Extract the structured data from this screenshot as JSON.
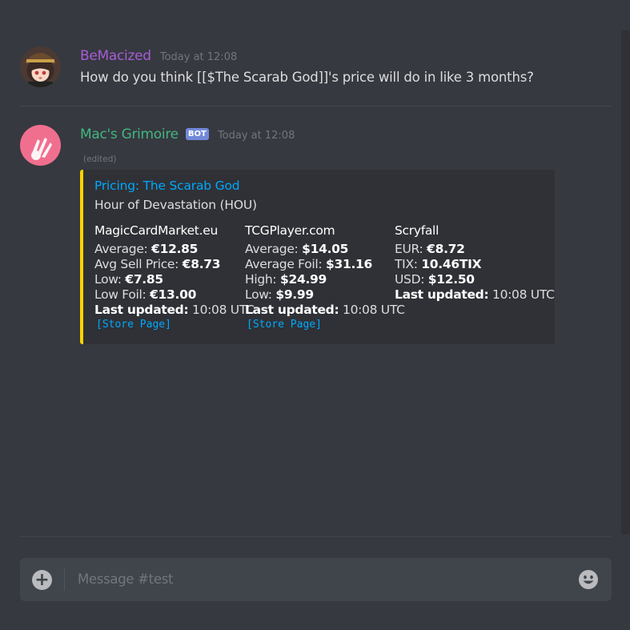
{
  "messages": [
    {
      "author": "BeMacized",
      "timestamp": "Today at 12:08",
      "content": "How do you think [[$The Scarab God]]'s price will do in like 3 months?"
    },
    {
      "author": "Mac's Grimoire",
      "bot_tag": "BOT",
      "timestamp": "Today at 12:08",
      "edited": "(edited)",
      "embed": {
        "title": "Pricing: The Scarab God",
        "description": "Hour of Devastation (HOU)",
        "accent_color": "#ffd200",
        "fields": [
          {
            "name": "MagicCardMarket.eu",
            "lines": [
              {
                "label": "Average: ",
                "value": "€12.85"
              },
              {
                "label": "Avg Sell Price: ",
                "value": "€8.73"
              },
              {
                "label": "Low: ",
                "value": "€7.85"
              },
              {
                "label": "Low Foil: ",
                "value": "€13.00"
              }
            ],
            "updated_label": "Last updated:",
            "updated_value": " 10:08 UTC",
            "link": "[Store Page]"
          },
          {
            "name": "TCGPlayer.com",
            "lines": [
              {
                "label": "Average: ",
                "value": "$14.05"
              },
              {
                "label": "Average Foil: ",
                "value": "$31.16"
              },
              {
                "label": "High: ",
                "value": "$24.99"
              },
              {
                "label": "Low: ",
                "value": "$9.99"
              }
            ],
            "updated_label": "Last updated:",
            "updated_value": " 10:08 UTC",
            "link": "[Store Page]"
          },
          {
            "name": "Scryfall",
            "lines": [
              {
                "label": "EUR: ",
                "value": "€8.72"
              },
              {
                "label": "TIX: ",
                "value": "10.46TIX"
              },
              {
                "label": "USD: ",
                "value": "$12.50"
              }
            ],
            "updated_label": "Last updated:",
            "updated_value": " 10:08 UTC"
          }
        ]
      }
    }
  ],
  "composer": {
    "placeholder": "Message #test",
    "plus_icon": "plus-circle-icon",
    "emoji_icon": "smiley-icon"
  },
  "colors": {
    "background": "#36393f",
    "user1": "#a65cd6",
    "user2": "#43b581",
    "link": "#00a8fc",
    "bot_tag": "#7289da"
  }
}
